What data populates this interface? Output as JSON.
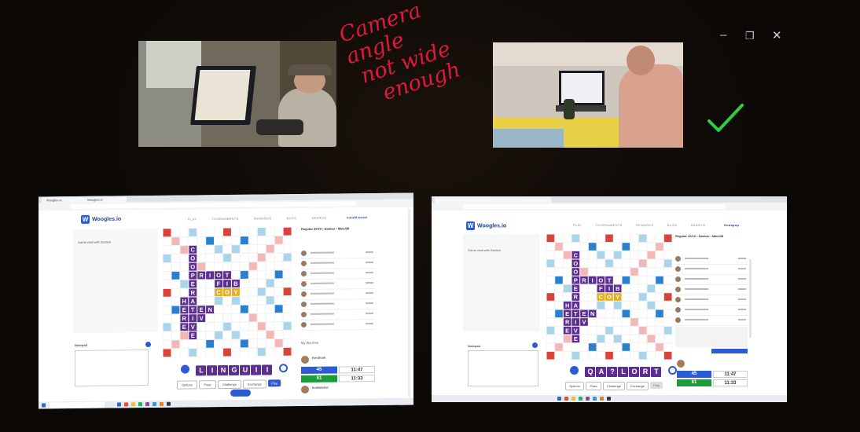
{
  "window_controls": {
    "minimize": "–",
    "restore": "❐",
    "close": "✕"
  },
  "annotation": {
    "lines": [
      "Camera angle",
      "not wide",
      "enough"
    ],
    "color": "#e0183c",
    "check_color": "#2ecc40"
  },
  "left_screen": {
    "tabs": [
      "Woogles.io",
      "Woogles.io"
    ],
    "site_name": "Woogles.io",
    "nav": [
      "PLAY",
      "TOURNAMENTS",
      "REWARDS",
      "BLOG",
      "SEARCH"
    ],
    "header_name": "conditioned",
    "game_title": "Regular 20/10 • Dantus • Male/28",
    "chat_label": "Notepad",
    "chat_heading": "Game chat with Section",
    "rack": [
      "L",
      "I",
      "N",
      "G",
      "U",
      "I",
      "I"
    ],
    "buttons": [
      "Options",
      "Pass",
      "Challenge",
      "Exchange",
      "Play"
    ],
    "player1": "Kerplunk",
    "player2": "leotwitcher",
    "score1": "45",
    "score2": "61",
    "time1": "11:47",
    "time2": "11:33",
    "word_list_label": "My Word list"
  },
  "right_screen": {
    "site_name": "Woogles.io",
    "nav": [
      "PLAY",
      "TOURNAMENTS",
      "REWARDS",
      "BLOG",
      "SEARCH"
    ],
    "header_name": "Sodapop",
    "game_title": "Regular 20/10 • Dantus • Male/28",
    "chat_label": "Notepad",
    "chat_heading": "Game chat with Section",
    "rack": [
      "Q",
      "A",
      "?",
      "L",
      "O",
      "R",
      "T"
    ],
    "buttons": [
      "Options",
      "Pass",
      "Challenge",
      "Exchange",
      "Play"
    ],
    "score1": "45",
    "score2": "61",
    "time1": "11:47",
    "time2": "11:33"
  },
  "board_words": [
    {
      "word": "COOPERATIVE"
    },
    {
      "word": "RIOT"
    },
    {
      "word": "FIB"
    },
    {
      "word": "COY"
    },
    {
      "word": "HERE"
    }
  ]
}
